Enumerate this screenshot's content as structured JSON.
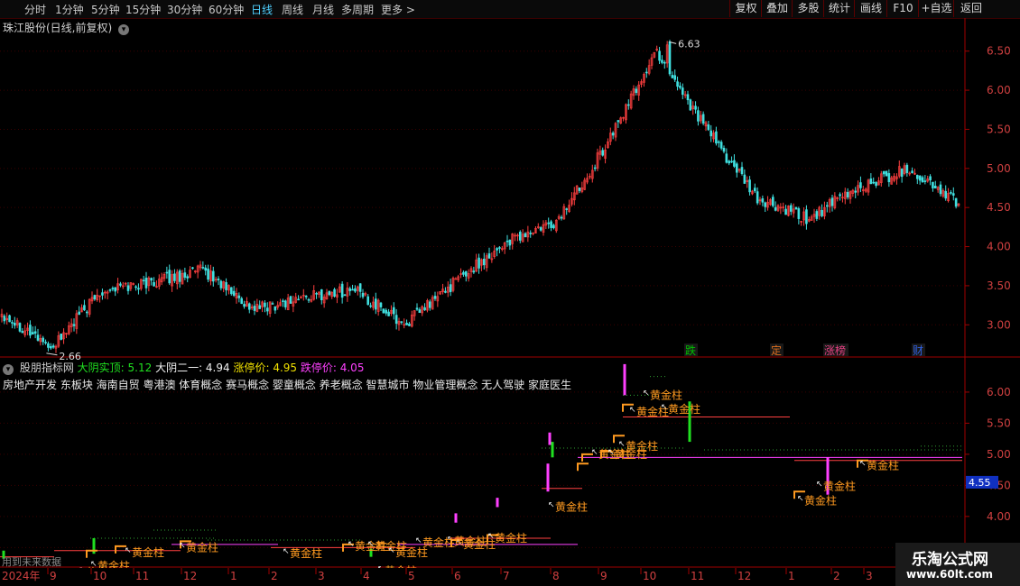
{
  "toolbar": {
    "timeframes": [
      {
        "label": "分时",
        "active": false
      },
      {
        "label": "1分钟",
        "active": false
      },
      {
        "label": "5分钟",
        "active": false
      },
      {
        "label": "15分钟",
        "active": false
      },
      {
        "label": "30分钟",
        "active": false
      },
      {
        "label": "60分钟",
        "active": false
      },
      {
        "label": "日线",
        "active": true
      },
      {
        "label": "周线",
        "active": false
      },
      {
        "label": "月线",
        "active": false
      },
      {
        "label": "多周期",
        "active": false
      },
      {
        "label": "更多 >",
        "active": false
      }
    ],
    "buttons": [
      "复权",
      "叠加",
      "多股",
      "统计",
      "画线",
      "F10",
      "+自选",
      "返回"
    ]
  },
  "price_panel": {
    "title": "珠江股份(日线,前复权)",
    "y_ticks": [
      "6.50",
      "6.00",
      "5.50",
      "5.00",
      "4.50",
      "4.00",
      "3.50",
      "3.00"
    ],
    "high_label": "6.63",
    "low_label": "2.66",
    "event_markers": [
      {
        "label": "跌",
        "color": "#00c000"
      },
      {
        "label": "定",
        "color": "#e07020"
      },
      {
        "label": "涨榜",
        "color": "#e04080"
      },
      {
        "label": "财",
        "color": "#3060e0"
      }
    ]
  },
  "indicator_panel": {
    "name": "股朋指标网",
    "metrics": [
      {
        "label": "大阴实顶: 5.12",
        "color": "#20e020"
      },
      {
        "label": "大阴二一: 4.94",
        "color": "#f0f0f0"
      },
      {
        "label": "涨停价: 4.95",
        "color": "#f0e000"
      },
      {
        "label": "跌停价: 4.05",
        "color": "#ff40ff"
      }
    ],
    "concepts": "房地产开发 东板块 海南自贸 粤港澳 体育概念 赛马概念 婴童概念 养老概念 智慧城市 物业管理概念 无人驾驶 家庭医生",
    "y_ticks": [
      "6.00",
      "5.50",
      "5.00",
      "4.50",
      "4.00",
      "3.50"
    ],
    "current_value": "4.55",
    "signal_label": "黄金柱",
    "future_hint": "用到未来数据"
  },
  "x_axis": {
    "year_label": "2024年",
    "months": [
      "9",
      "10",
      "11",
      "12",
      "1",
      "2",
      "3",
      "4",
      "5",
      "6",
      "7",
      "8",
      "9",
      "10",
      "11",
      "12",
      "1",
      "2",
      "3"
    ]
  },
  "watermark": {
    "name": "乐淘公式网",
    "url": "www.60lt.com"
  },
  "colors": {
    "up": "#ff4040",
    "down": "#40e0e0",
    "axis": "#a00000",
    "signal": "#ff9a20",
    "pink": "#ff40ff"
  },
  "chart_data": {
    "type": "candlestick",
    "title": "珠江股份(日线,前复权)",
    "y_range": [
      2.6,
      6.9
    ],
    "keypoints": [
      {
        "date": "2024-08",
        "close": 3.15
      },
      {
        "date": "2024-09",
        "close": 2.72
      },
      {
        "date": "2024-10",
        "close": 3.45
      },
      {
        "date": "2024-11",
        "close": 3.55
      },
      {
        "date": "2024-12",
        "close": 3.7
      },
      {
        "date": "2025-01",
        "close": 3.2
      },
      {
        "date": "2025-02",
        "close": 3.35
      },
      {
        "date": "2025-03",
        "close": 3.45
      },
      {
        "date": "2025-04",
        "close": 3.0
      },
      {
        "date": "2025-05",
        "close": 3.55
      },
      {
        "date": "2025-06",
        "close": 4.05
      },
      {
        "date": "2025-07",
        "close": 4.3
      },
      {
        "date": "2025-08",
        "close": 5.3
      },
      {
        "date": "2025-09",
        "close": 6.5
      },
      {
        "date": "2025-10",
        "close": 5.5
      },
      {
        "date": "2025-11",
        "close": 4.6
      },
      {
        "date": "2025-12",
        "close": 4.35
      },
      {
        "date": "2026-01",
        "close": 4.75
      },
      {
        "date": "2026-02",
        "close": 5.0
      },
      {
        "date": "2026-03",
        "close": 4.55
      }
    ],
    "max": 6.63,
    "min": 2.66
  }
}
